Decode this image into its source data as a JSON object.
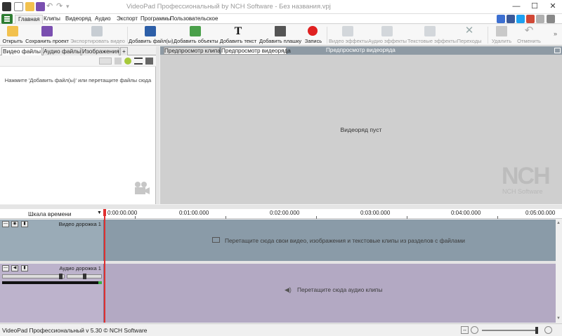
{
  "window": {
    "title": "VideoPad Профессиональный by NCH Software - Без названия.vpj",
    "minimize": "—",
    "maximize": "☐",
    "close": "✕"
  },
  "menu": {
    "items": [
      "Главная",
      "Клипы",
      "Видеоряд",
      "Аудио",
      "Экспорт",
      "Программы",
      "Пользовательское"
    ]
  },
  "ribbon": {
    "buttons": [
      {
        "label": "Открыть",
        "icon": "folder-icon",
        "enabled": true
      },
      {
        "label": "Сохранить проект",
        "icon": "floppy-icon",
        "enabled": true
      },
      {
        "label": "Экспортировать видео",
        "icon": "film-export-icon",
        "enabled": false
      },
      {
        "label": "Добавить файл(ы)",
        "icon": "add-file-icon",
        "enabled": true
      },
      {
        "label": "Добавить объекты",
        "icon": "add-objects-icon",
        "enabled": true
      },
      {
        "label": "Добавить текст",
        "icon": "text-icon",
        "enabled": true
      },
      {
        "label": "Добавить плашку",
        "icon": "slide-icon",
        "enabled": true
      },
      {
        "label": "Запись",
        "icon": "record-icon",
        "enabled": true
      },
      {
        "label": "Видео эффекты",
        "icon": "fx-icon",
        "enabled": false
      },
      {
        "label": "Аудио эффекты",
        "icon": "audio-fx-icon",
        "enabled": false
      },
      {
        "label": "Текстовые эффекты",
        "icon": "text-fx-icon",
        "enabled": false
      },
      {
        "label": "Переходы",
        "icon": "transition-icon",
        "enabled": false
      },
      {
        "label": "Удалить",
        "icon": "trash-icon",
        "enabled": false
      },
      {
        "label": "Отменить",
        "icon": "undo-icon",
        "enabled": false
      }
    ]
  },
  "bin": {
    "tabs": [
      "Видео файлы",
      "Аудио файлы",
      "Изображения",
      "+"
    ],
    "active_tab": "Видео файлы",
    "hint": "Нажмите 'Добавить файл(ы)' или перетащите файлы сюда"
  },
  "preview": {
    "tabs": [
      "Предпросмотр клипа",
      "Предпросмотр видеоряда"
    ],
    "title": "Предпросмотр видеоряда",
    "empty_text": "Видеоряд пуст",
    "watermark": "NCH",
    "watermark_sub": "NCH Software"
  },
  "timeline": {
    "scale_label": "Шкала времени",
    "ruler": [
      "0:00:00.000",
      "0:01:00.000",
      "0:02:00.000",
      "0:03:00.000",
      "0:04:00.000",
      "0:05:00.000"
    ],
    "video_track": {
      "name": "Видео дорожка 1",
      "hint": "Перетащите сюда свои видео, изображения и текстовые клипы из разделов с файлами"
    },
    "audio_track": {
      "name": "Аудио дорожка 1",
      "hint": "Перетащите сюда аудио клипы"
    }
  },
  "status": {
    "text": "VideoPad Профессиональный v 5.30 © NCH Software"
  },
  "colors": {
    "accent_green": "#2e7d32",
    "record_red": "#e02020",
    "video_track": "#8a9ba8",
    "audio_track": "#b3a9c3",
    "playhead": "#e03030"
  }
}
